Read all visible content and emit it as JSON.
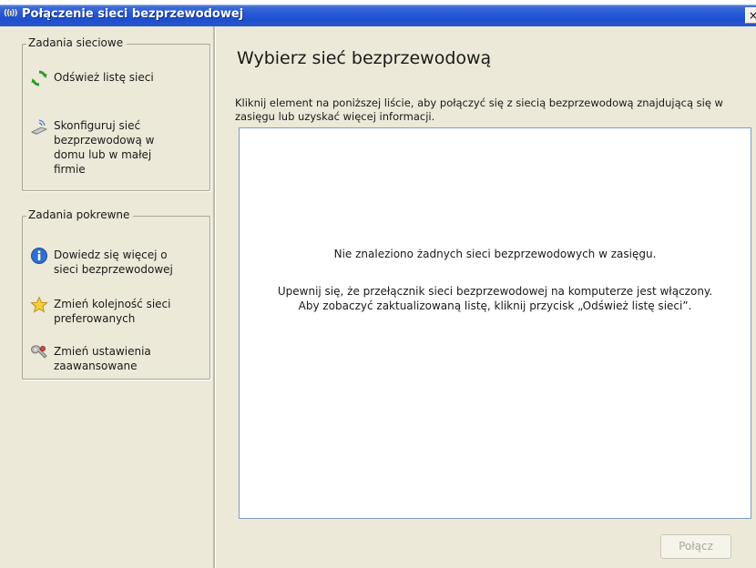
{
  "window": {
    "title": "Połączenie sieci bezprzewodowej",
    "title_icon_glyph": "((ı))",
    "close_glyph": "×"
  },
  "sidebar": {
    "network_tasks": {
      "title": "Zadania sieciowe",
      "items": [
        {
          "label": "Odśwież listę sieci",
          "icon": "refresh-icon"
        },
        {
          "label": "Skonfiguruj sieć bezprzewodową w domu lub w małej firmie",
          "icon": "wireless-setup-icon"
        }
      ]
    },
    "related_tasks": {
      "title": "Zadania pokrewne",
      "items": [
        {
          "label": "Dowiedz się więcej o sieci bezprzewodowej",
          "icon": "info-icon"
        },
        {
          "label": "Zmień kolejność sieci preferowanych",
          "icon": "star-icon"
        },
        {
          "label": "Zmień ustawienia zaawansowane",
          "icon": "settings-icon"
        }
      ]
    }
  },
  "main": {
    "heading": "Wybierz sieć bezprzewodową",
    "instruction": "Kliknij element na poniższej liście, aby połączyć się z siecią bezprzewodową znajdującą się w zasięgu lub uzyskać więcej informacji.",
    "empty_message": "Nie znaleziono żadnych sieci bezprzewodowych w zasięgu.",
    "hint_line1": "Upewnij się, że przełącznik sieci bezprzewodowej na komputerze jest włączony.",
    "hint_line2": "Aby zobaczyć zaktualizowaną listę, kliknij przycisk „Odśwież listę sieci”.",
    "connect_label": "Połącz"
  },
  "colors": {
    "titlebar": "#2659d8",
    "window_bg": "#ece9d8",
    "list_border": "#7f9db9",
    "disabled_text": "#aca899"
  }
}
